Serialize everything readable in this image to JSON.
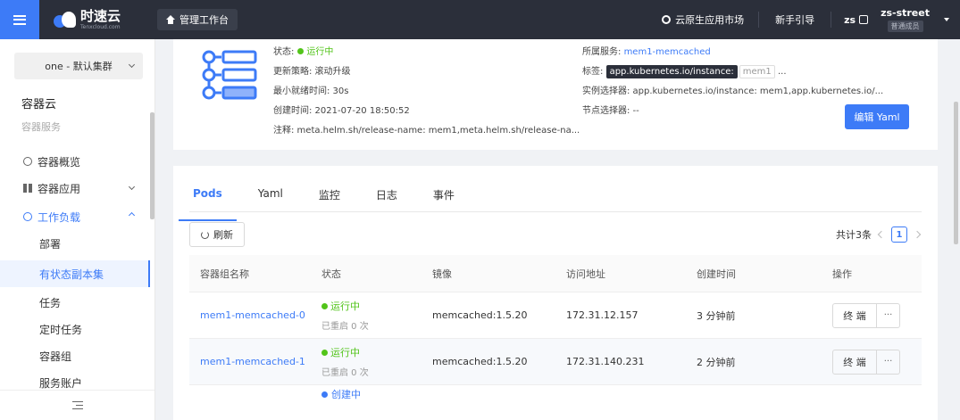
{
  "topbar": {
    "logo_text": "时速云",
    "logo_sub": "Tenxcloud.com",
    "workbench": "管理工作台",
    "market": "云原生应用市场",
    "guide": "新手引导",
    "user_short": "zs",
    "user_name": "zs-street",
    "user_role": "普通成员"
  },
  "sidebar": {
    "cluster": "one - 默认集群",
    "section_title": "容器云",
    "section_sub": "容器服务",
    "nav": [
      {
        "label": "容器概览"
      },
      {
        "label": "容器应用"
      },
      {
        "label": "工作负载"
      }
    ],
    "sub_items": [
      "部署",
      "有状态副本集",
      "任务",
      "定时任务",
      "容器组",
      "服务账户"
    ]
  },
  "info": {
    "status_label": "状态:",
    "status_value": "运行中",
    "strategy": "更新策略: 滚动升级",
    "min_ready": "最小就绪时间: 30s",
    "created": "创建时间: 2021-07-20 18:50:52",
    "annotation": "注释: meta.helm.sh/release-name: mem1,meta.helm.sh/release-na...",
    "service_label": "所属服务:",
    "service_value": "mem1-memcached",
    "tag_label": "标签:",
    "tag_key": "app.kubernetes.io/instance:",
    "tag_value": "mem1",
    "tag_more": "...",
    "instance_selector": "实例选择器: app.kubernetes.io/instance: mem1,app.kubernetes.io/...",
    "node_selector": "节点选择器: --",
    "edit_yaml": "编辑 Yaml"
  },
  "tabs": [
    "Pods",
    "Yaml",
    "监控",
    "日志",
    "事件"
  ],
  "toolbar": {
    "refresh": "刷新",
    "total": "共计3条",
    "page": "1"
  },
  "table": {
    "headers": [
      "容器组名称",
      "状态",
      "镜像",
      "访问地址",
      "创建时间",
      "操作"
    ],
    "rows": [
      {
        "name": "mem1-memcached-0",
        "status": "运行中",
        "restarts": "已重启 0 次",
        "image": "memcached:1.5.20",
        "address": "172.31.12.157",
        "created": "3 分钟前",
        "op": "终 端",
        "more": "···"
      },
      {
        "name": "mem1-memcached-1",
        "status": "运行中",
        "restarts": "已重启 0 次",
        "image": "memcached:1.5.20",
        "address": "172.31.140.231",
        "created": "2 分钟前",
        "op": "终 端",
        "more": "···"
      },
      {
        "name": "",
        "status": "创建中",
        "restarts": "",
        "image": "",
        "address": "",
        "created": "",
        "op": "",
        "more": ""
      }
    ]
  },
  "colors": {
    "accent": "#3d7bf7",
    "topbar": "#2b2f3a",
    "running": "#52c41a"
  }
}
